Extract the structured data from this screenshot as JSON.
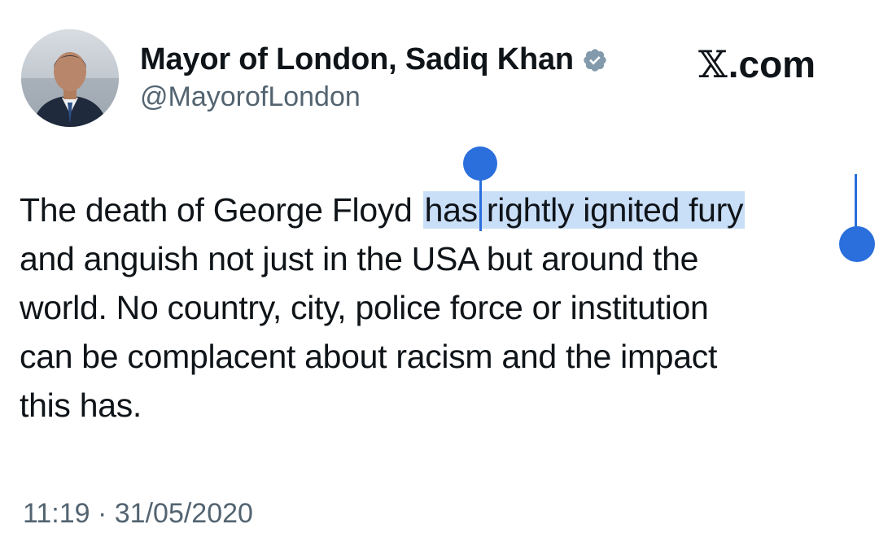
{
  "tweet": {
    "author": {
      "display_name": "Mayor of London, Sadiq Khan",
      "handle": "@MayorofLondon",
      "verified_icon": "verified-badge-icon",
      "avatar": "profile-photo"
    },
    "watermark": {
      "x_glyph": "𝕏",
      "suffix": ".com"
    },
    "text_lines": [
      {
        "before": "The death of George Floyd",
        "selected": "has rightly ignited fury"
      },
      {
        "text": "and anguish not just in the USA but around the"
      },
      {
        "text": "world. No country, city, police force or institution"
      },
      {
        "text": "can be complacent about racism and the impact"
      },
      {
        "text": "this has."
      }
    ],
    "timestamp": "11:19 · 31/05/2020"
  },
  "colors": {
    "text": "#0f1419",
    "secondary_text": "#536471",
    "selection_highlight": "#c9def7",
    "selection_handle": "#2a6fdc",
    "verified_badge": "#829aab"
  }
}
